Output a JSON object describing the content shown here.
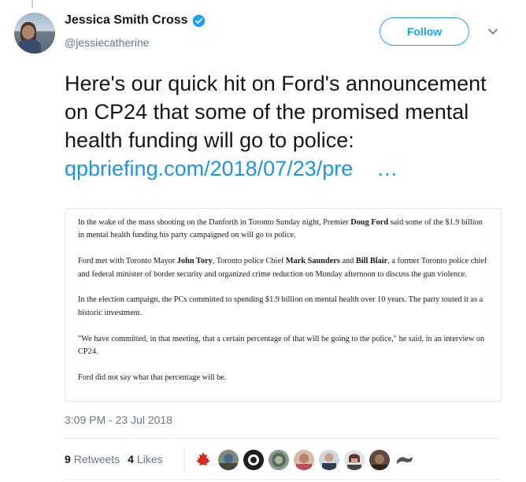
{
  "author": {
    "name": "Jessica Smith Cross",
    "handle": "@jessiecatherine",
    "verified": true
  },
  "actions": {
    "follow_label": "Follow"
  },
  "tweet": {
    "text_line": "Here's our quick hit on Ford's announcement on CP24 that some of the promised mental health funding will go to police:",
    "link_text": "qpbriefing.com/2018/07/23/pre",
    "link_ellipsis": "…"
  },
  "article": {
    "p1_a": "In the wake of the mass shooting on the Danforth in Toronto Sunday night, Premier ",
    "p1_b": "Doug Ford",
    "p1_c": " said some of the $1.9 billion in mental health funding his party campaigned on will go to police.",
    "p2_a": "Ford met with Toronto Mayor ",
    "p2_b": "John Tory",
    "p2_c": ", Toronto police Chief ",
    "p2_d": "Mark Saunders",
    "p2_e": " and ",
    "p2_f": "Bill Blair",
    "p2_g": ", a former Toronto police chief and federal minister of border security and organized crime reduction on Monday afternoon to discuss the gun violence.",
    "p3": "In the election campaign, the PCs committed to spending $1.9 billion on mental health over 10 years. The party touted it as a historic investment.",
    "p4": "\"We have committed, in that meeting, that a certain percentage of that will be going to the police,\" he said, in an interview on CP24.",
    "p5": "Ford did not say what that percentage will be."
  },
  "timestamp": "3:09 PM - 23 Jul 2018",
  "stats": {
    "retweets_count": "9",
    "retweets_label": "Retweets",
    "likes_count": "4",
    "likes_label": "Likes"
  },
  "likers": [
    "maple-leaf-avatar",
    "user-avatar",
    "user-avatar",
    "user-avatar",
    "user-avatar",
    "user-avatar",
    "user-avatar",
    "user-avatar",
    "user-avatar"
  ],
  "colors": {
    "accent": "#1da1f2",
    "link": "#1b95e0",
    "secondary_text": "#657786",
    "border": "#e1e8ed"
  }
}
